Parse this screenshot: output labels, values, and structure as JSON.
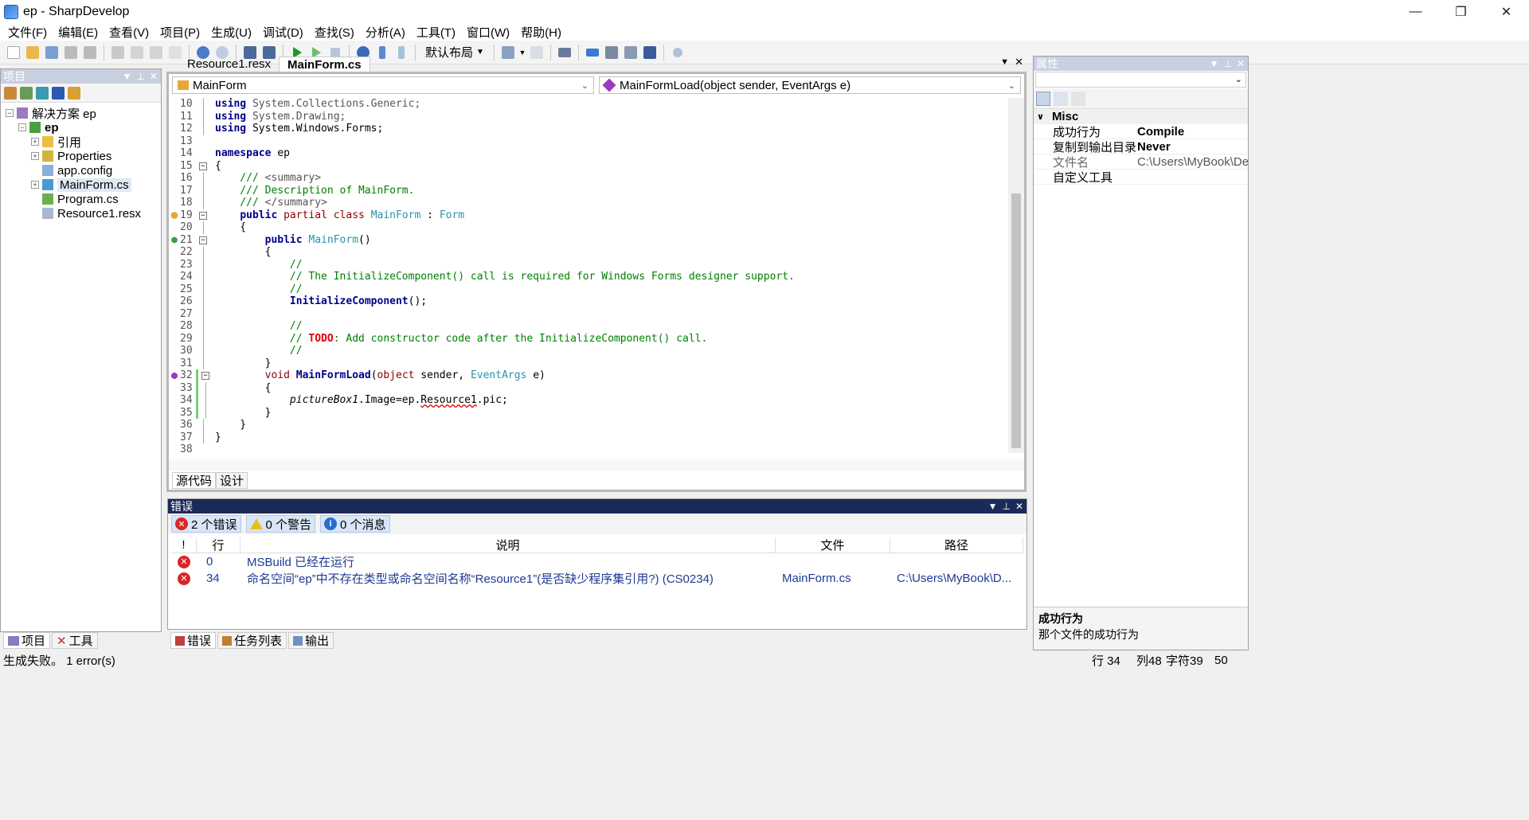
{
  "window": {
    "title": "ep - SharpDevelop",
    "minimize": "—",
    "maximize": "❐",
    "close": "✕"
  },
  "menu": [
    "文件(F)",
    "编辑(E)",
    "查看(V)",
    "项目(P)",
    "生成(U)",
    "调试(D)",
    "查找(S)",
    "分析(A)",
    "工具(T)",
    "窗口(W)",
    "帮助(H)"
  ],
  "toolbar": {
    "layout_combo": "默认布局"
  },
  "project_panel": {
    "title": "项目",
    "tree": [
      {
        "label": "解决方案 ep",
        "level": 0,
        "expander": "−"
      },
      {
        "label": "ep",
        "level": 1,
        "expander": "−",
        "bold": true
      },
      {
        "label": "引用",
        "level": 2,
        "expander": "+"
      },
      {
        "label": "Properties",
        "level": 2,
        "expander": "+"
      },
      {
        "label": "app.config",
        "level": 2,
        "expander": ""
      },
      {
        "label": "MainForm.cs",
        "level": 2,
        "expander": "+",
        "selected": true
      },
      {
        "label": "Program.cs",
        "level": 2,
        "expander": ""
      },
      {
        "label": "Resource1.resx",
        "level": 2,
        "expander": ""
      }
    ],
    "tabs": [
      "项目",
      "工具"
    ]
  },
  "editor": {
    "tabs": [
      "Resource1.resx",
      "MainForm.cs"
    ],
    "class_combo": "MainForm",
    "member_combo": "MainFormLoad(object sender, EventArgs e)",
    "bottom_tabs": [
      "源代码",
      "设计"
    ],
    "line_numbers": [
      "10",
      "11",
      "12",
      "13",
      "14",
      "15",
      "16",
      "17",
      "18",
      "19",
      "20",
      "21",
      "22",
      "23",
      "24",
      "25",
      "26",
      "27",
      "28",
      "29",
      "30",
      "31",
      "32",
      "33",
      "34",
      "35",
      "36",
      "37",
      "38"
    ]
  },
  "error_panel": {
    "title": "错误",
    "filters": {
      "errors": "2 个错误",
      "warnings": "0 个警告",
      "messages": "0 个消息"
    },
    "columns": {
      "icon": "!",
      "line": "行",
      "description": "说明",
      "file": "文件",
      "path": "路径"
    },
    "rows": [
      {
        "line": "0",
        "description": "MSBuild 已经在运行",
        "file": "",
        "path": ""
      },
      {
        "line": "34",
        "description": "命名空间“ep”中不存在类型或命名空间名称“Resource1”(是否缺少程序集引用?) (CS0234)",
        "file": "MainForm.cs",
        "path": "C:\\Users\\MyBook\\D..."
      }
    ],
    "tabs": [
      "错误",
      "任务列表",
      "输出"
    ]
  },
  "properties_panel": {
    "title": "属性",
    "category": "Misc",
    "rows": [
      {
        "name": "成功行为",
        "value": "Compile",
        "bold": true
      },
      {
        "name": "复制到输出目录",
        "value": "Never",
        "bold": true
      },
      {
        "name": "文件名",
        "value": "C:\\Users\\MyBook\\Deskt",
        "bold": false,
        "gray": true
      },
      {
        "name": "自定义工具",
        "value": "",
        "bold": false
      }
    ],
    "desc_title": "成功行为",
    "desc_text": "那个文件的成功行为"
  },
  "status": {
    "message": "生成失败。 1 error(s)",
    "line": "行 34",
    "col": "列48",
    "char": "字符39",
    "extra": "50"
  },
  "colors": {
    "accent_dark": "#1b2a5a",
    "error_red": "#d9262a",
    "keyword": "#00008b",
    "comment": "#008000",
    "type": "#2b91af"
  }
}
